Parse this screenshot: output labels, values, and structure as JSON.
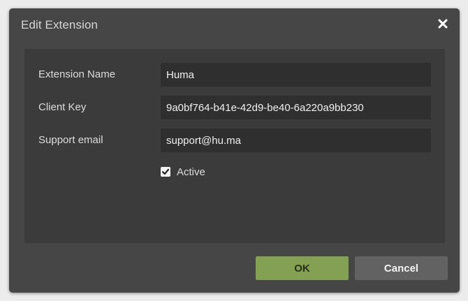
{
  "dialog": {
    "title": "Edit Extension",
    "close_icon": "close-icon"
  },
  "form": {
    "name": {
      "label": "Extension Name",
      "value": "Huma"
    },
    "client_key": {
      "label": "Client Key",
      "value": "9a0bf764-b41e-42d9-be40-6a220a9bb230"
    },
    "support_email": {
      "label": "Support email",
      "value": "support@hu.ma"
    },
    "active": {
      "label": "Active",
      "checked": true
    }
  },
  "buttons": {
    "ok_label": "OK",
    "cancel_label": "Cancel"
  },
  "colors": {
    "dialog_bg": "#464646",
    "panel_bg": "#3b3b3b",
    "field_bg": "#2f2f2f",
    "ok_bg": "#84a053",
    "cancel_bg": "#626262"
  }
}
